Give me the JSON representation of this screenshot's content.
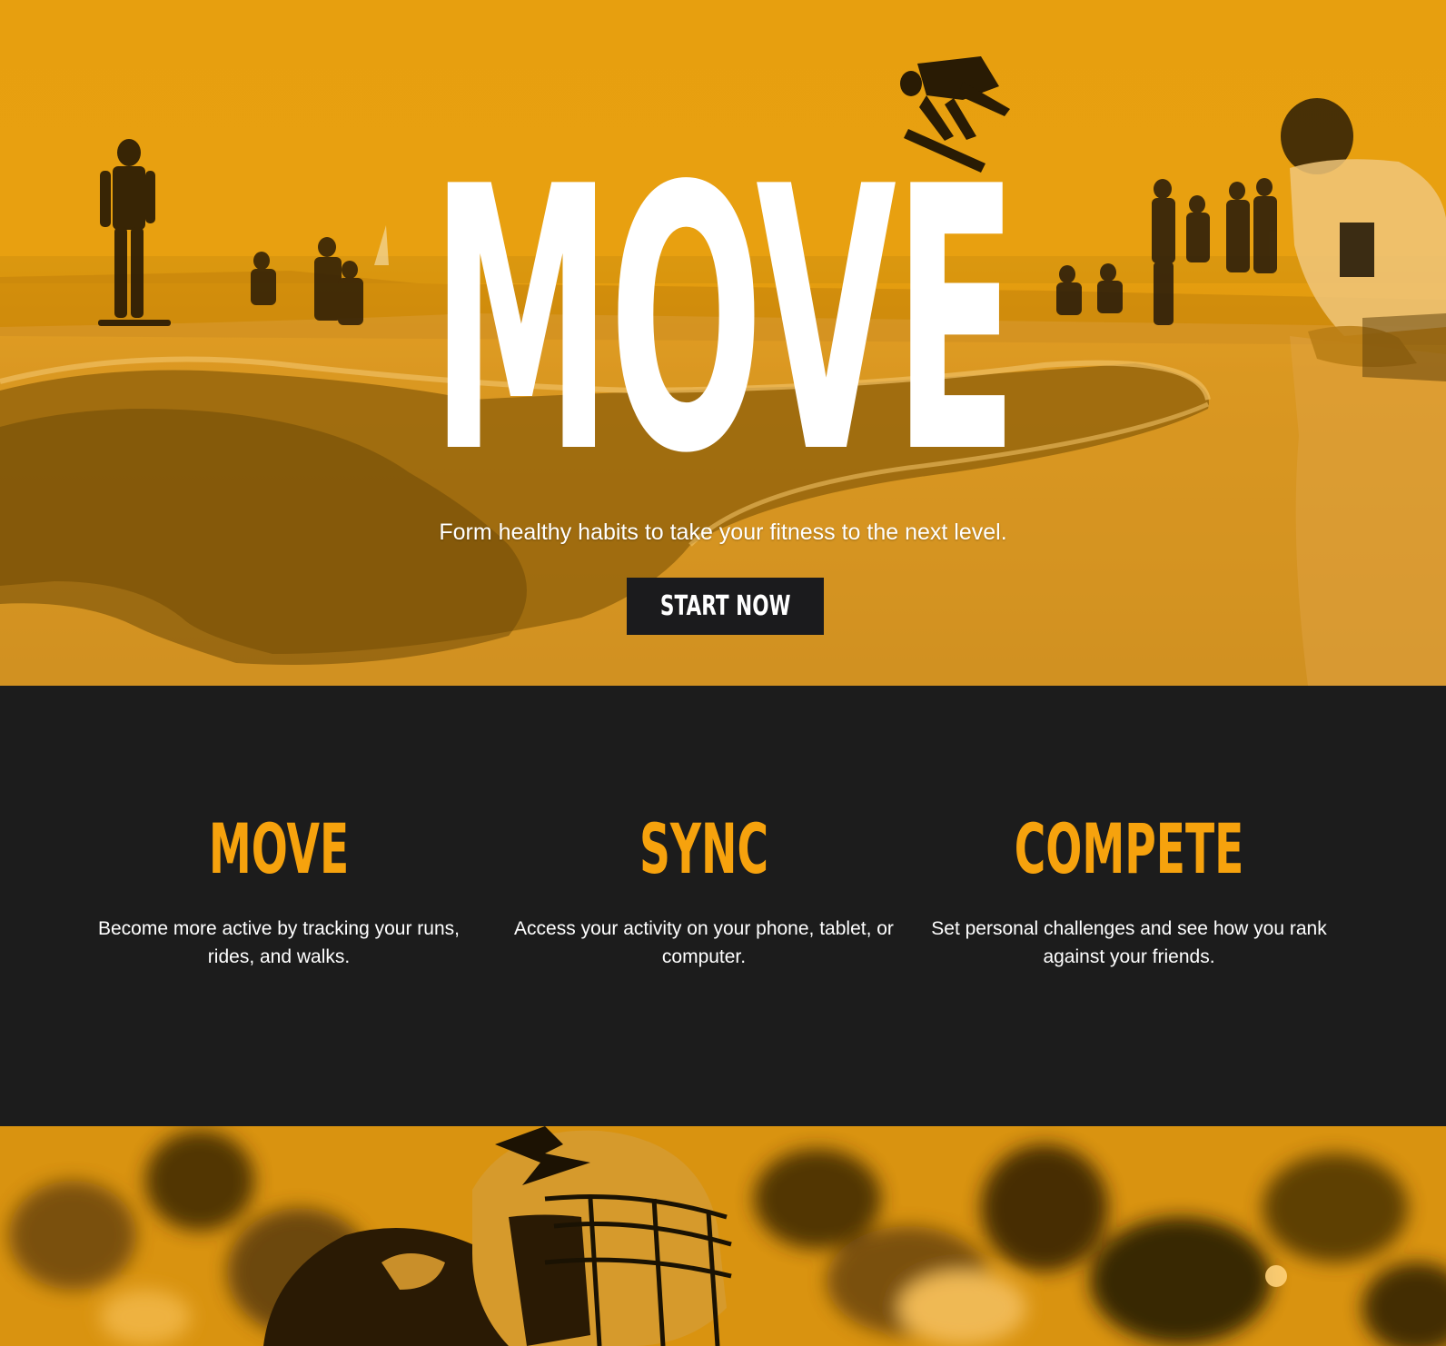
{
  "hero": {
    "title": "MOVE",
    "tagline": "Form healthy habits to take your fitness to the next level.",
    "cta_label": "START NOW",
    "image": "skatepark-photo",
    "accent_color": "#f6a20d",
    "overlay_color": "#e8a010"
  },
  "features": [
    {
      "title": "MOVE",
      "text": "Become more active by tracking your runs, rides, and walks."
    },
    {
      "title": "SYNC",
      "text": "Access your activity on your phone, tablet, or computer."
    },
    {
      "title": "COMPETE",
      "text": "Set personal challenges and see how you rank against your friends."
    }
  ],
  "features_background": "#1c1c1c",
  "bottom_band": {
    "image": "football-player-photo"
  }
}
